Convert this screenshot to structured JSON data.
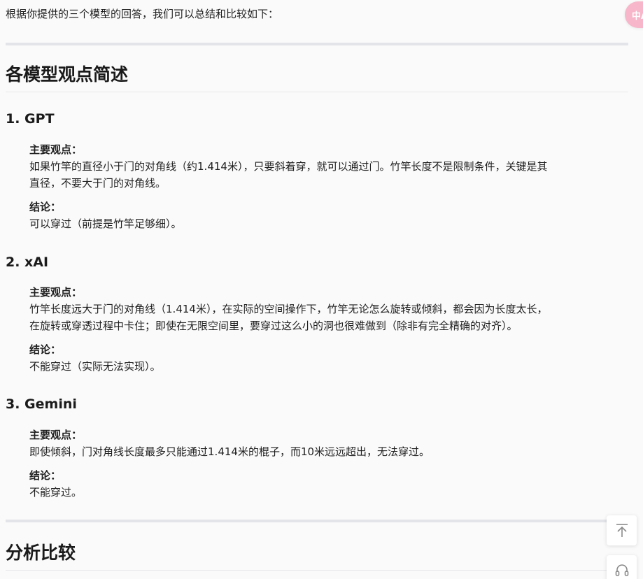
{
  "intro": "根据你提供的三个模型的回答，我们可以总结和比较如下：",
  "section1": {
    "title": "各模型观点简述"
  },
  "models": [
    {
      "title": "1. GPT",
      "view_label": "主要观点：",
      "view_lines": [
        "如果竹竿的直径小于门的对角线（约1.414米），只要斜着穿，就可以通过门。竹竿长度不是限制条件，关键是其",
        "直径，不要大于门的对角线。"
      ],
      "conclusion_label": "结论：",
      "conclusion": "可以穿过（前提是竹竿足够细）。"
    },
    {
      "title": "2. xAI",
      "view_label": "主要观点：",
      "view_lines": [
        "竹竿长度远大于门的对角线（1.414米），在实际的空间操作下，竹竿无论怎么旋转或倾斜，都会因为长度太长，",
        "在旋转或穿透过程中卡住；即使在无限空间里，要穿过这么小的洞也很难做到（除非有完全精确的对齐）。"
      ],
      "conclusion_label": "结论：",
      "conclusion": "不能穿过（实际无法实现）。"
    },
    {
      "title": "3. Gemini",
      "view_label": "主要观点：",
      "view_lines": [
        "即使倾斜，门对角线长度最多只能通过1.414米的棍子，而10米远远超出，无法穿过。"
      ],
      "conclusion_label": "结论：",
      "conclusion": "不能穿过。"
    }
  ],
  "section2": {
    "title": "分析比较"
  },
  "floating": {
    "translate_label": "中A",
    "back_to_top_icon": "back-to-top-icon",
    "support_icon": "headset-icon",
    "translate_color": "#f7b6c9"
  }
}
